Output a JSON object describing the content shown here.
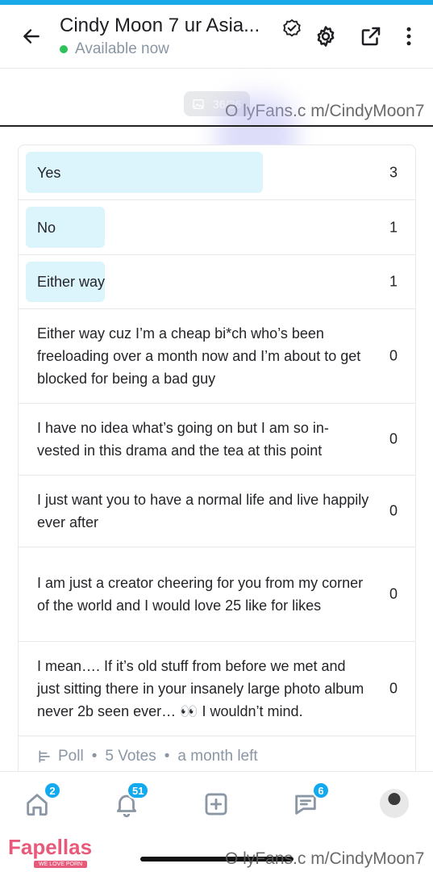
{
  "header": {
    "title": "Cindy Moon 7 ur Asia...",
    "status": "Available now"
  },
  "media_badge": "36/36",
  "watermark_text": "O lyFans.c m/CindyMoon7",
  "poll": {
    "options": [
      {
        "label": "Yes",
        "votes": "3",
        "share": 0.6
      },
      {
        "label": "No",
        "votes": "1",
        "share": 0.2
      },
      {
        "label": "Either way",
        "votes": "1",
        "share": 0.2
      },
      {
        "label": "Either way cuz I’m a cheap bi*ch who’s been freeloading over a month now and I’m about to get blocked for being a bad guy",
        "votes": "0",
        "share": 0
      },
      {
        "label": "I have no idea what’s going on but I am so in-vested in this drama and the tea at this point",
        "votes": "0",
        "share": 0
      },
      {
        "label": "I just want you to have a normal life and live happily ever after",
        "votes": "0",
        "share": 0
      },
      {
        "label": "I am just a creator cheering for you from my corner of the world and I would love 25 like for likes",
        "votes": "0",
        "share": 0
      },
      {
        "label": "I mean…. If it’s old stuff from before we met and just sitting there in your insanely large photo album never 2b seen ever… 👀 I wouldn’t mind.",
        "votes": "0",
        "share": 0
      }
    ],
    "footer": {
      "type": "Poll",
      "votes": "5 Votes",
      "time_left": "a month left"
    }
  },
  "nav": {
    "home_badge": "2",
    "notifications_badge": "51",
    "messages_badge": "6"
  },
  "logo": {
    "name": "Fapellas",
    "tagline": "WE LOVE PORN"
  },
  "colors": {
    "accent": "#12a9ef",
    "vote_fill": "#dcf4fb",
    "online": "#2fc25b"
  }
}
